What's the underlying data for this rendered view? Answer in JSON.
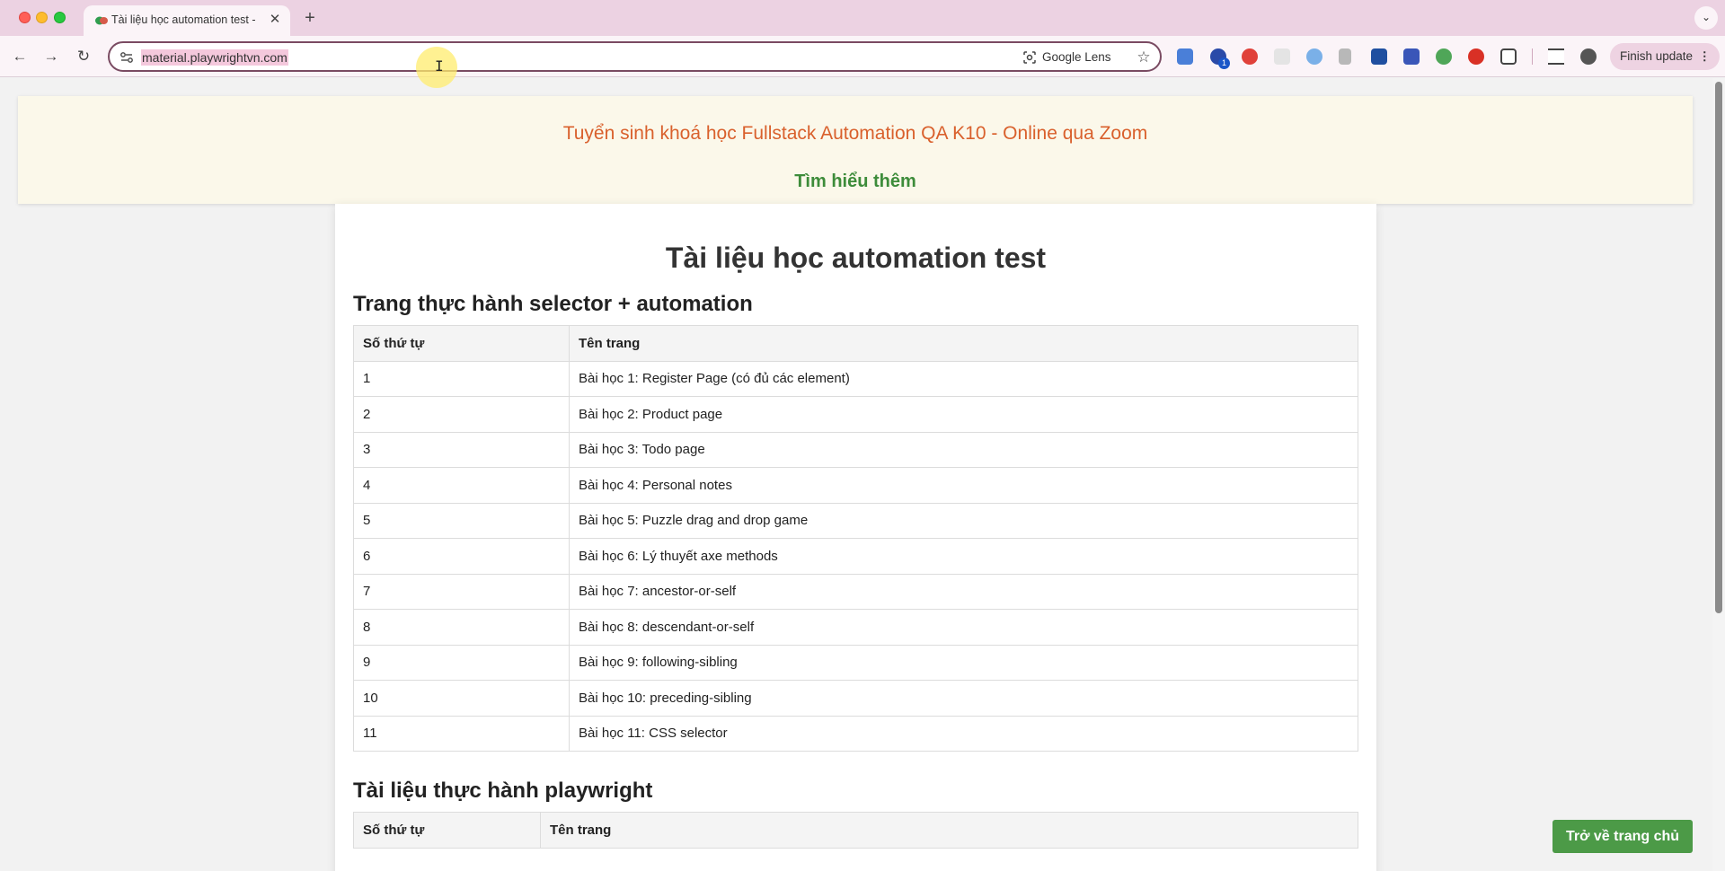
{
  "browser": {
    "tab": {
      "title": "Tài liệu học automation test -",
      "close_glyph": "✕"
    },
    "new_tab_glyph": "+",
    "tab_menu_glyph": "⌄",
    "nav": {
      "back_glyph": "←",
      "forward_glyph": "→",
      "reload_glyph": "↻"
    },
    "url": "material.playwrightvn.com",
    "google_lens_label": "Google Lens",
    "bookmark_glyph": "☆",
    "extension_badge": "1",
    "finish_update_label": "Finish update",
    "menu_glyph": "⋮",
    "cursor_glyph": "I"
  },
  "banner": {
    "title": "Tuyển sinh khoá học Fullstack Automation QA K10 - Online qua Zoom",
    "link": "Tìm hiểu thêm"
  },
  "page": {
    "title": "Tài liệu học automation test",
    "sections": [
      {
        "title": "Trang thực hành selector + automation",
        "columns": [
          "Số thứ tự",
          "Tên trang"
        ],
        "rows": [
          [
            "1",
            "Bài học 1: Register Page (có đủ các element)"
          ],
          [
            "2",
            "Bài học 2: Product page"
          ],
          [
            "3",
            "Bài học 3: Todo page"
          ],
          [
            "4",
            "Bài học 4: Personal notes"
          ],
          [
            "5",
            "Bài học 5: Puzzle drag and drop game"
          ],
          [
            "6",
            "Bài học 6: Lý thuyết axe methods"
          ],
          [
            "7",
            "Bài học 7: ancestor-or-self"
          ],
          [
            "8",
            "Bài học 8: descendant-or-self"
          ],
          [
            "9",
            "Bài học 9: following-sibling"
          ],
          [
            "10",
            "Bài học 10: preceding-sibling"
          ],
          [
            "11",
            "Bài học 11: CSS selector"
          ]
        ]
      },
      {
        "title": "Tài liệu thực hành playwright",
        "columns": [
          "Số thứ tự",
          "Tên trang"
        ],
        "rows": []
      }
    ]
  },
  "home_button": "Trở về trang chủ",
  "colors": {
    "banner_title": "#d9602c",
    "banner_link": "#3d8c3a",
    "home_button_bg": "#4c9a47",
    "tabbar_bg": "#ecd2e2"
  }
}
